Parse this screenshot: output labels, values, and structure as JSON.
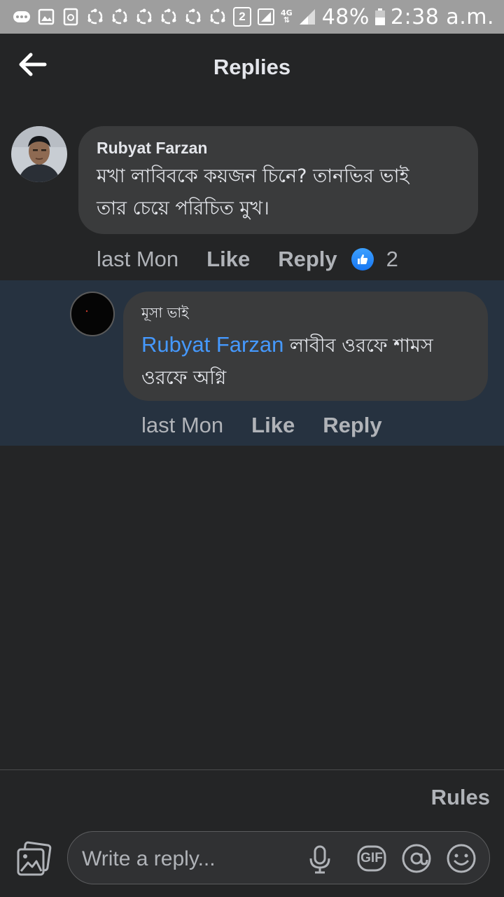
{
  "status_bar": {
    "notification_count": "2",
    "network": "4G",
    "battery": "48%",
    "time": "2:38 a.m."
  },
  "header": {
    "title": "Replies"
  },
  "comment": {
    "author": "Rubyat Farzan",
    "text_line1": "মখা লাবিবকে কয়জন চিনে? তানভির ভাই",
    "text_line2": "তার চেয়ে পরিচিত মুখ।",
    "time": "last Mon",
    "like_label": "Like",
    "reply_label": "Reply",
    "reaction_count": "2"
  },
  "reply": {
    "author": "মূসা ভাই",
    "mention": "Rubyat Farzan",
    "text_part1": " লাবীব ওরফে শামস",
    "text_line2": "ওরফে অগ্নি",
    "time": "last Mon",
    "like_label": "Like",
    "reply_label": "Reply"
  },
  "footer": {
    "rules_label": "Rules",
    "input_placeholder": "Write a reply...",
    "gif_label": "GIF"
  },
  "colors": {
    "background": "#242526",
    "bubble": "#3a3b3c",
    "highlight_band": "#263240",
    "mention": "#4599ff",
    "status_bar": "#9e9e9e",
    "like_badge": "#1877f2"
  }
}
